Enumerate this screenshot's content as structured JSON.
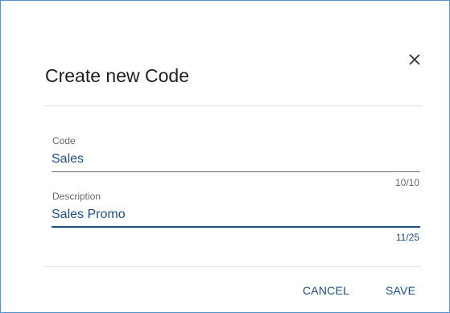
{
  "dialog": {
    "title": "Create new Code",
    "close_icon": "close-icon"
  },
  "fields": {
    "code": {
      "label": "Code",
      "value": "Sales",
      "counter": "10/10"
    },
    "description": {
      "label": "Description",
      "value": "Sales Promo",
      "counter": "11/25"
    }
  },
  "actions": {
    "cancel_label": "CANCEL",
    "save_label": "SAVE"
  },
  "colors": {
    "accent": "#1d4f86",
    "border": "#5b8fc9"
  }
}
